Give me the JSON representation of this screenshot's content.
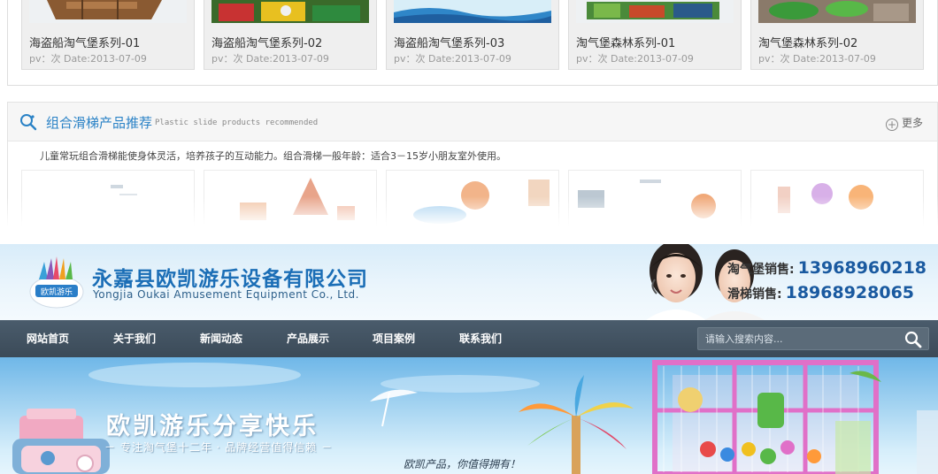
{
  "featured_products": [
    {
      "title": "海盗船淘气堡系列-01",
      "meta": "pv：次 Date:2013-07-09"
    },
    {
      "title": "海盗船淘气堡系列-02",
      "meta": "pv：次 Date:2013-07-09"
    },
    {
      "title": "海盗船淘气堡系列-03",
      "meta": "pv：次 Date:2013-07-09"
    },
    {
      "title": "淘气堡森林系列-01",
      "meta": "pv：次 Date:2013-07-09"
    },
    {
      "title": "淘气堡森林系列-02",
      "meta": "pv：次 Date:2013-07-09"
    }
  ],
  "slide_section": {
    "title": "组合滑梯产品推荐",
    "subtitle": "Plastic slide products recommended",
    "more_label": "更多",
    "description": "儿童常玩组合滑梯能使身体灵活，培养孩子的互动能力。组合滑梯一般年龄：适合3－15岁小朋友室外使用。",
    "icon": "search-magnifier-icon"
  },
  "header": {
    "company_name": "永嘉县欧凯游乐设备有限公司",
    "company_name_en": "Yongjia Oukai Amusement Equipment Co., Ltd.",
    "logo_text": "欧凯游乐",
    "hotlines": [
      {
        "label": "淘气堡销售:",
        "number": "13968960218"
      },
      {
        "label": "滑梯销售:",
        "number": "18968928065"
      }
    ]
  },
  "nav": {
    "items": [
      "网站首页",
      "关于我们",
      "新闻动态",
      "产品展示",
      "项目案例",
      "联系我们"
    ],
    "search_placeholder": "请输入搜索内容..."
  },
  "banner": {
    "title": "欧凯游乐分享快乐",
    "subtitle": "－ 专注淘气堡十二年 · 品牌经营值得信赖 －",
    "slogan": "欧凯产品，你值得拥有！"
  },
  "colors": {
    "accent_blue": "#2a82c6",
    "brand_blue": "#1b6eb6",
    "nav_bg": "#44545f",
    "phone_blue": "#1a5aa0"
  }
}
